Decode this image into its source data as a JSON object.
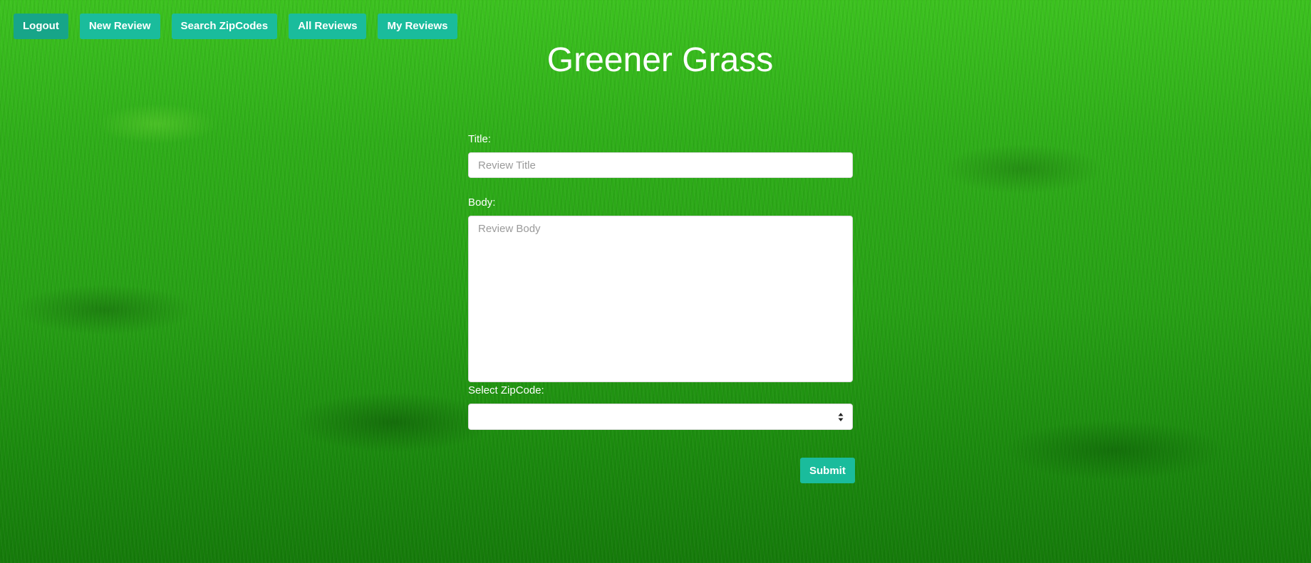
{
  "nav": {
    "buttons": [
      {
        "label": "Logout"
      },
      {
        "label": "New Review"
      },
      {
        "label": "Search ZipCodes"
      },
      {
        "label": "All Reviews"
      },
      {
        "label": "My Reviews"
      }
    ]
  },
  "header": {
    "title": "Greener Grass"
  },
  "form": {
    "title_label": "Title:",
    "title_placeholder": "Review Title",
    "body_label": "Body:",
    "body_placeholder": "Review Body",
    "zipcode_label": "Select ZipCode:",
    "zipcode_selected": "",
    "submit_label": "Submit"
  },
  "colors": {
    "accent": "#1abc9c",
    "accent_active": "#17a589",
    "background": "#2fae19"
  }
}
